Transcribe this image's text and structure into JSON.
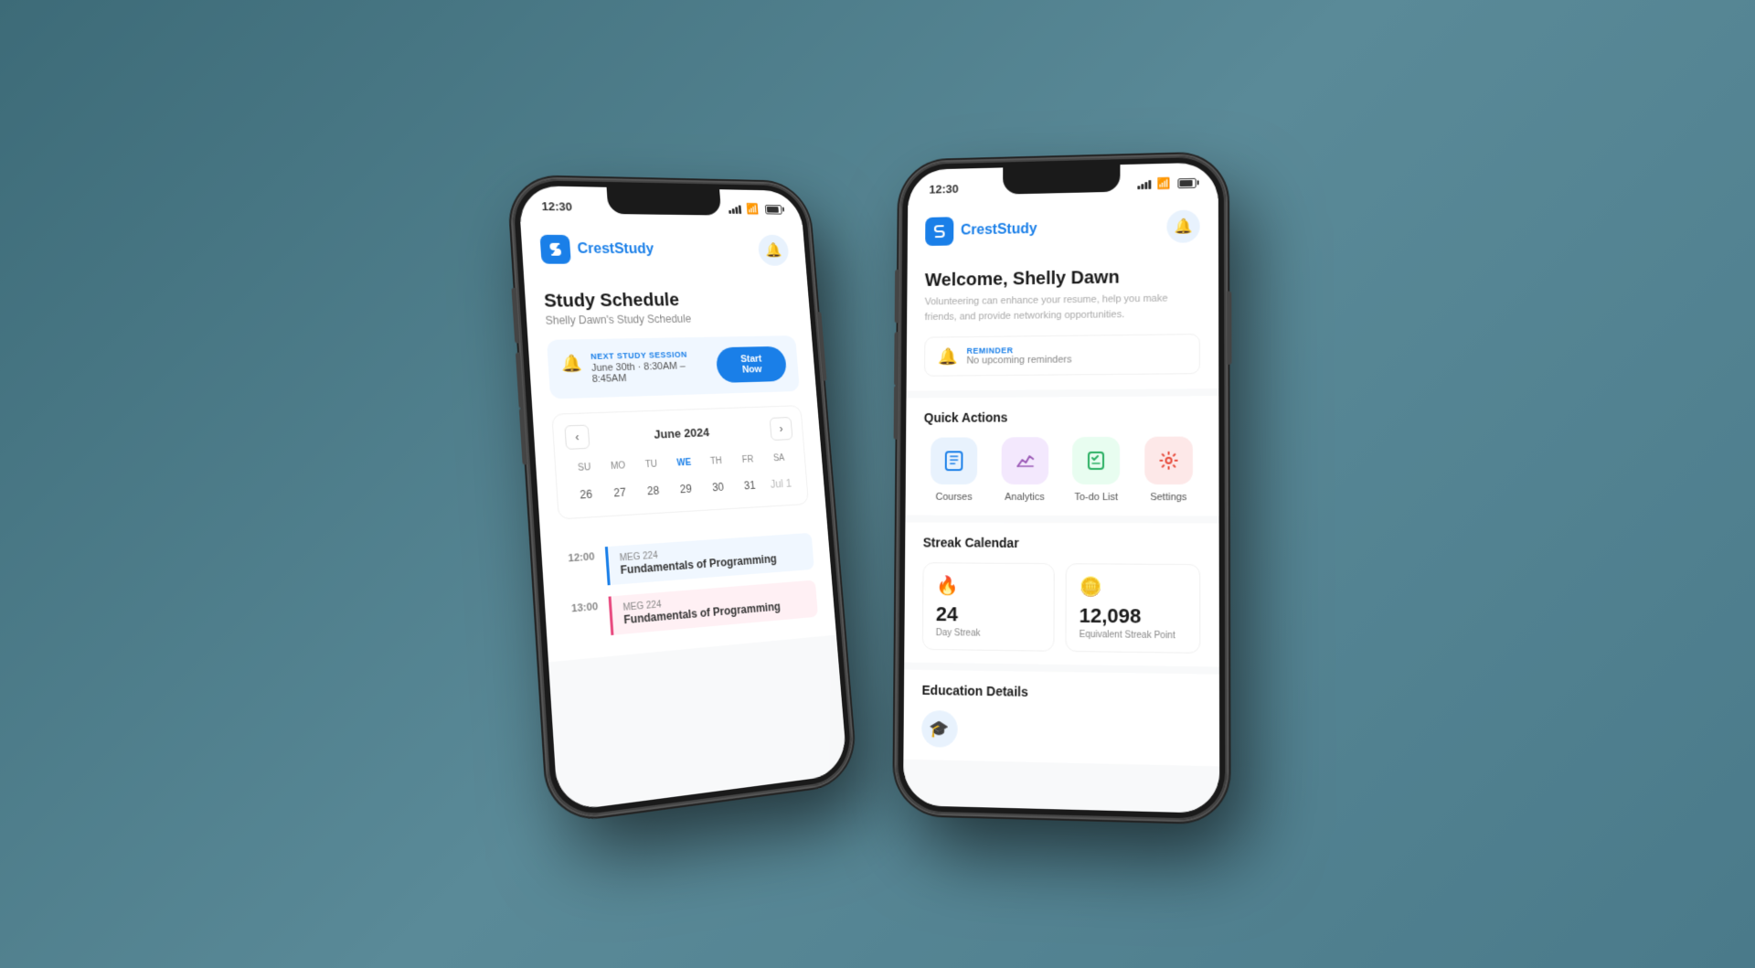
{
  "app": {
    "name": "CrestStudy",
    "logo_letter": "S"
  },
  "status_bar": {
    "time": "12:30",
    "signal": "4 bars",
    "wifi": "on",
    "battery": "full"
  },
  "left_phone": {
    "header": {
      "logo": "CrestStudy",
      "bell_aria": "notifications"
    },
    "page": {
      "title": "Study Schedule",
      "subtitle": "Shelly Dawn's Study Schedule"
    },
    "next_session": {
      "label": "NEXT STUDY SESSION",
      "date": "June 30th · 8:30AM – 8:45AM",
      "button": "Start Now"
    },
    "calendar": {
      "month": "June 2024",
      "prev_aria": "previous month",
      "next_aria": "next month",
      "day_names": [
        "SU",
        "MO",
        "TU",
        "WE",
        "TH",
        "FR",
        "SA"
      ],
      "active_day": "WE",
      "dates": [
        "26",
        "27",
        "28",
        "29",
        "30",
        "31",
        "Jul 1"
      ],
      "today_date": "29",
      "muted_date": "Jul 1"
    },
    "schedule": [
      {
        "time": "12:00",
        "course_code": "MEG 224",
        "course_name": "Fundamentals of Programming",
        "color": "blue"
      },
      {
        "time": "13:00",
        "course_code": "MEG 224",
        "course_name": "Fundamentals of Programming",
        "color": "pink"
      }
    ]
  },
  "right_phone": {
    "header": {
      "logo": "CrestStudy",
      "bell_aria": "notifications"
    },
    "welcome": {
      "title": "Welcome, Shelly Dawn",
      "subtitle": "Volunteering can enhance your resume, help you make friends, and provide networking opportunities."
    },
    "reminder": {
      "label": "REMINDER",
      "text": "No upcoming reminders"
    },
    "quick_actions": {
      "title": "Quick Actions",
      "items": [
        {
          "label": "Courses",
          "icon": "📘",
          "color": "blue"
        },
        {
          "label": "Analytics",
          "icon": "📊",
          "color": "purple"
        },
        {
          "label": "To-do List",
          "icon": "✅",
          "color": "green"
        },
        {
          "label": "Settings",
          "icon": "⚙️",
          "color": "red"
        }
      ]
    },
    "streak_calendar": {
      "title": "Streak Calendar",
      "items": [
        {
          "icon": "🔥",
          "number": "24",
          "label": "Day Streak"
        },
        {
          "icon": "🪙",
          "number": "12,098",
          "label": "Equivalent Streak Point"
        }
      ]
    },
    "education_details": {
      "title": "Education Details"
    }
  }
}
